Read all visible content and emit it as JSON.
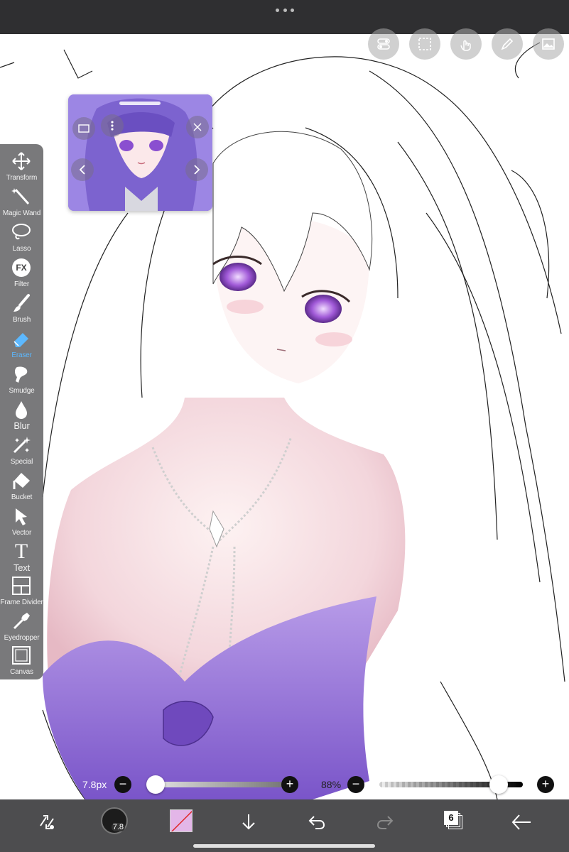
{
  "toolbar": {
    "tools": [
      {
        "label": "Transform",
        "icon": "move-arrows-icon"
      },
      {
        "label": "Magic Wand",
        "icon": "magic-wand-icon"
      },
      {
        "label": "Lasso",
        "icon": "lasso-icon"
      },
      {
        "label": "Filter",
        "icon": "fx-icon",
        "glyph": "FX"
      },
      {
        "label": "Brush",
        "icon": "brush-icon"
      },
      {
        "label": "Eraser",
        "icon": "eraser-icon",
        "active": true
      },
      {
        "label": "Smudge",
        "icon": "smudge-icon"
      },
      {
        "label": "Blur",
        "icon": "blur-drop-icon"
      },
      {
        "label": "Special",
        "icon": "special-sparkle-icon"
      },
      {
        "label": "Bucket",
        "icon": "bucket-icon"
      },
      {
        "label": "Vector",
        "icon": "vector-cursor-icon"
      },
      {
        "label": "Text",
        "icon": "text-icon",
        "glyph": "T"
      },
      {
        "label": "Frame Divider",
        "icon": "frame-divider-icon"
      },
      {
        "label": "Eyedropper",
        "icon": "eyedropper-icon"
      },
      {
        "label": "Canvas",
        "icon": "canvas-icon"
      }
    ],
    "active_color": "#5cb8ff"
  },
  "top_tools": [
    "toggles-icon",
    "selection-icon",
    "touch-icon",
    "pen-icon",
    "layer-image-icon"
  ],
  "reference_window": {
    "icons": [
      "window-icon",
      "more-icon",
      "close-icon",
      "prev-icon",
      "next-icon"
    ]
  },
  "sliders": {
    "brush_size_label": "7.8px",
    "brush_size_fraction": 0.0,
    "opacity_label": "88%",
    "opacity_fraction": 0.88,
    "minus": "−",
    "plus": "+"
  },
  "bottom_bar": {
    "brush_size_value": "7.8",
    "layer_count": "6",
    "primary_color": "#e3b6e8",
    "icons": [
      "swap-icon",
      "brush-size-icon",
      "color-icon",
      "import-icon",
      "undo-icon",
      "redo-icon",
      "layers-icon",
      "back-icon"
    ]
  },
  "colors": {
    "toolbar_bg": "#6e6e70",
    "status_bar_bg": "#2f2f31",
    "bottom_bar_bg": "#464648"
  }
}
